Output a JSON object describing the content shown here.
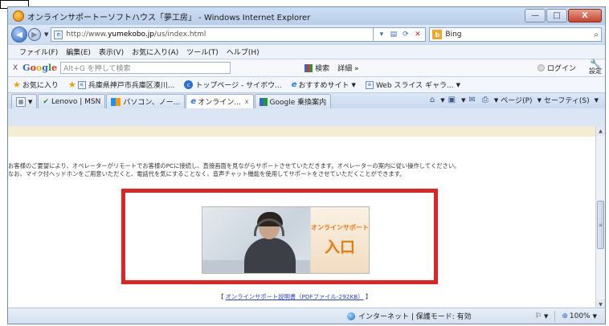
{
  "window": {
    "title": "オンラインサポートーソフトハウス「夢工房」 - Windows Internet Explorer",
    "minimize": "—",
    "maximize": "□",
    "close": "X"
  },
  "address": {
    "url_prefix": "http://www.",
    "url_domain": "yumekobo.jp",
    "url_path": "/us/index.html",
    "search_engine": "Bing"
  },
  "menu": {
    "items": [
      "ファイル(F)",
      "編集(E)",
      "表示(V)",
      "お気に入り(A)",
      "ツール(T)",
      "ヘルプ(H)"
    ]
  },
  "google_bar": {
    "close": "X",
    "input_placeholder": "Alt+G を押して検索",
    "search_label": "検索",
    "detail_label": "詳細 »",
    "login_label": "ログイン",
    "settings_label": "設定"
  },
  "favorites": {
    "favorites_label": "お気に入り",
    "items": [
      "兵庫県神戸市兵庫区湊川...",
      "トップページ - サイボウ...",
      "おすすめサイト",
      "Web スライス ギャラ..."
    ]
  },
  "tabs": {
    "items": [
      {
        "label": "Lenovo | MSN"
      },
      {
        "label": "パソコン、ノー..."
      },
      {
        "label": "オンライン..."
      },
      {
        "label": "Google 乗換案内"
      }
    ],
    "close_glyph": "x",
    "page_menu": "ページ(P)",
    "safety_menu": "セーフティ(S)"
  },
  "content": {
    "line1": "お客様のご要望により、オペレーターがリモートでお客様のPCに接続し、直接画面を見ながらサポートさせていただきます。オペレーターの案内に従い操作してください。",
    "line2": "なお、マイク付ヘッドホンをご用意いただくと、電話代を気にすることなく、音声チャット機能を使用してサポートをさせていただくことができます。",
    "banner_small": "オンラインサポート",
    "banner_big": "入口",
    "manual_open": "【",
    "manual_link": "オンラインサポート説明書（PDFファイル-292KB）",
    "manual_close": "】"
  },
  "status": {
    "zone": "インターネット | 保護モード: 有効",
    "zoom": "100%"
  }
}
